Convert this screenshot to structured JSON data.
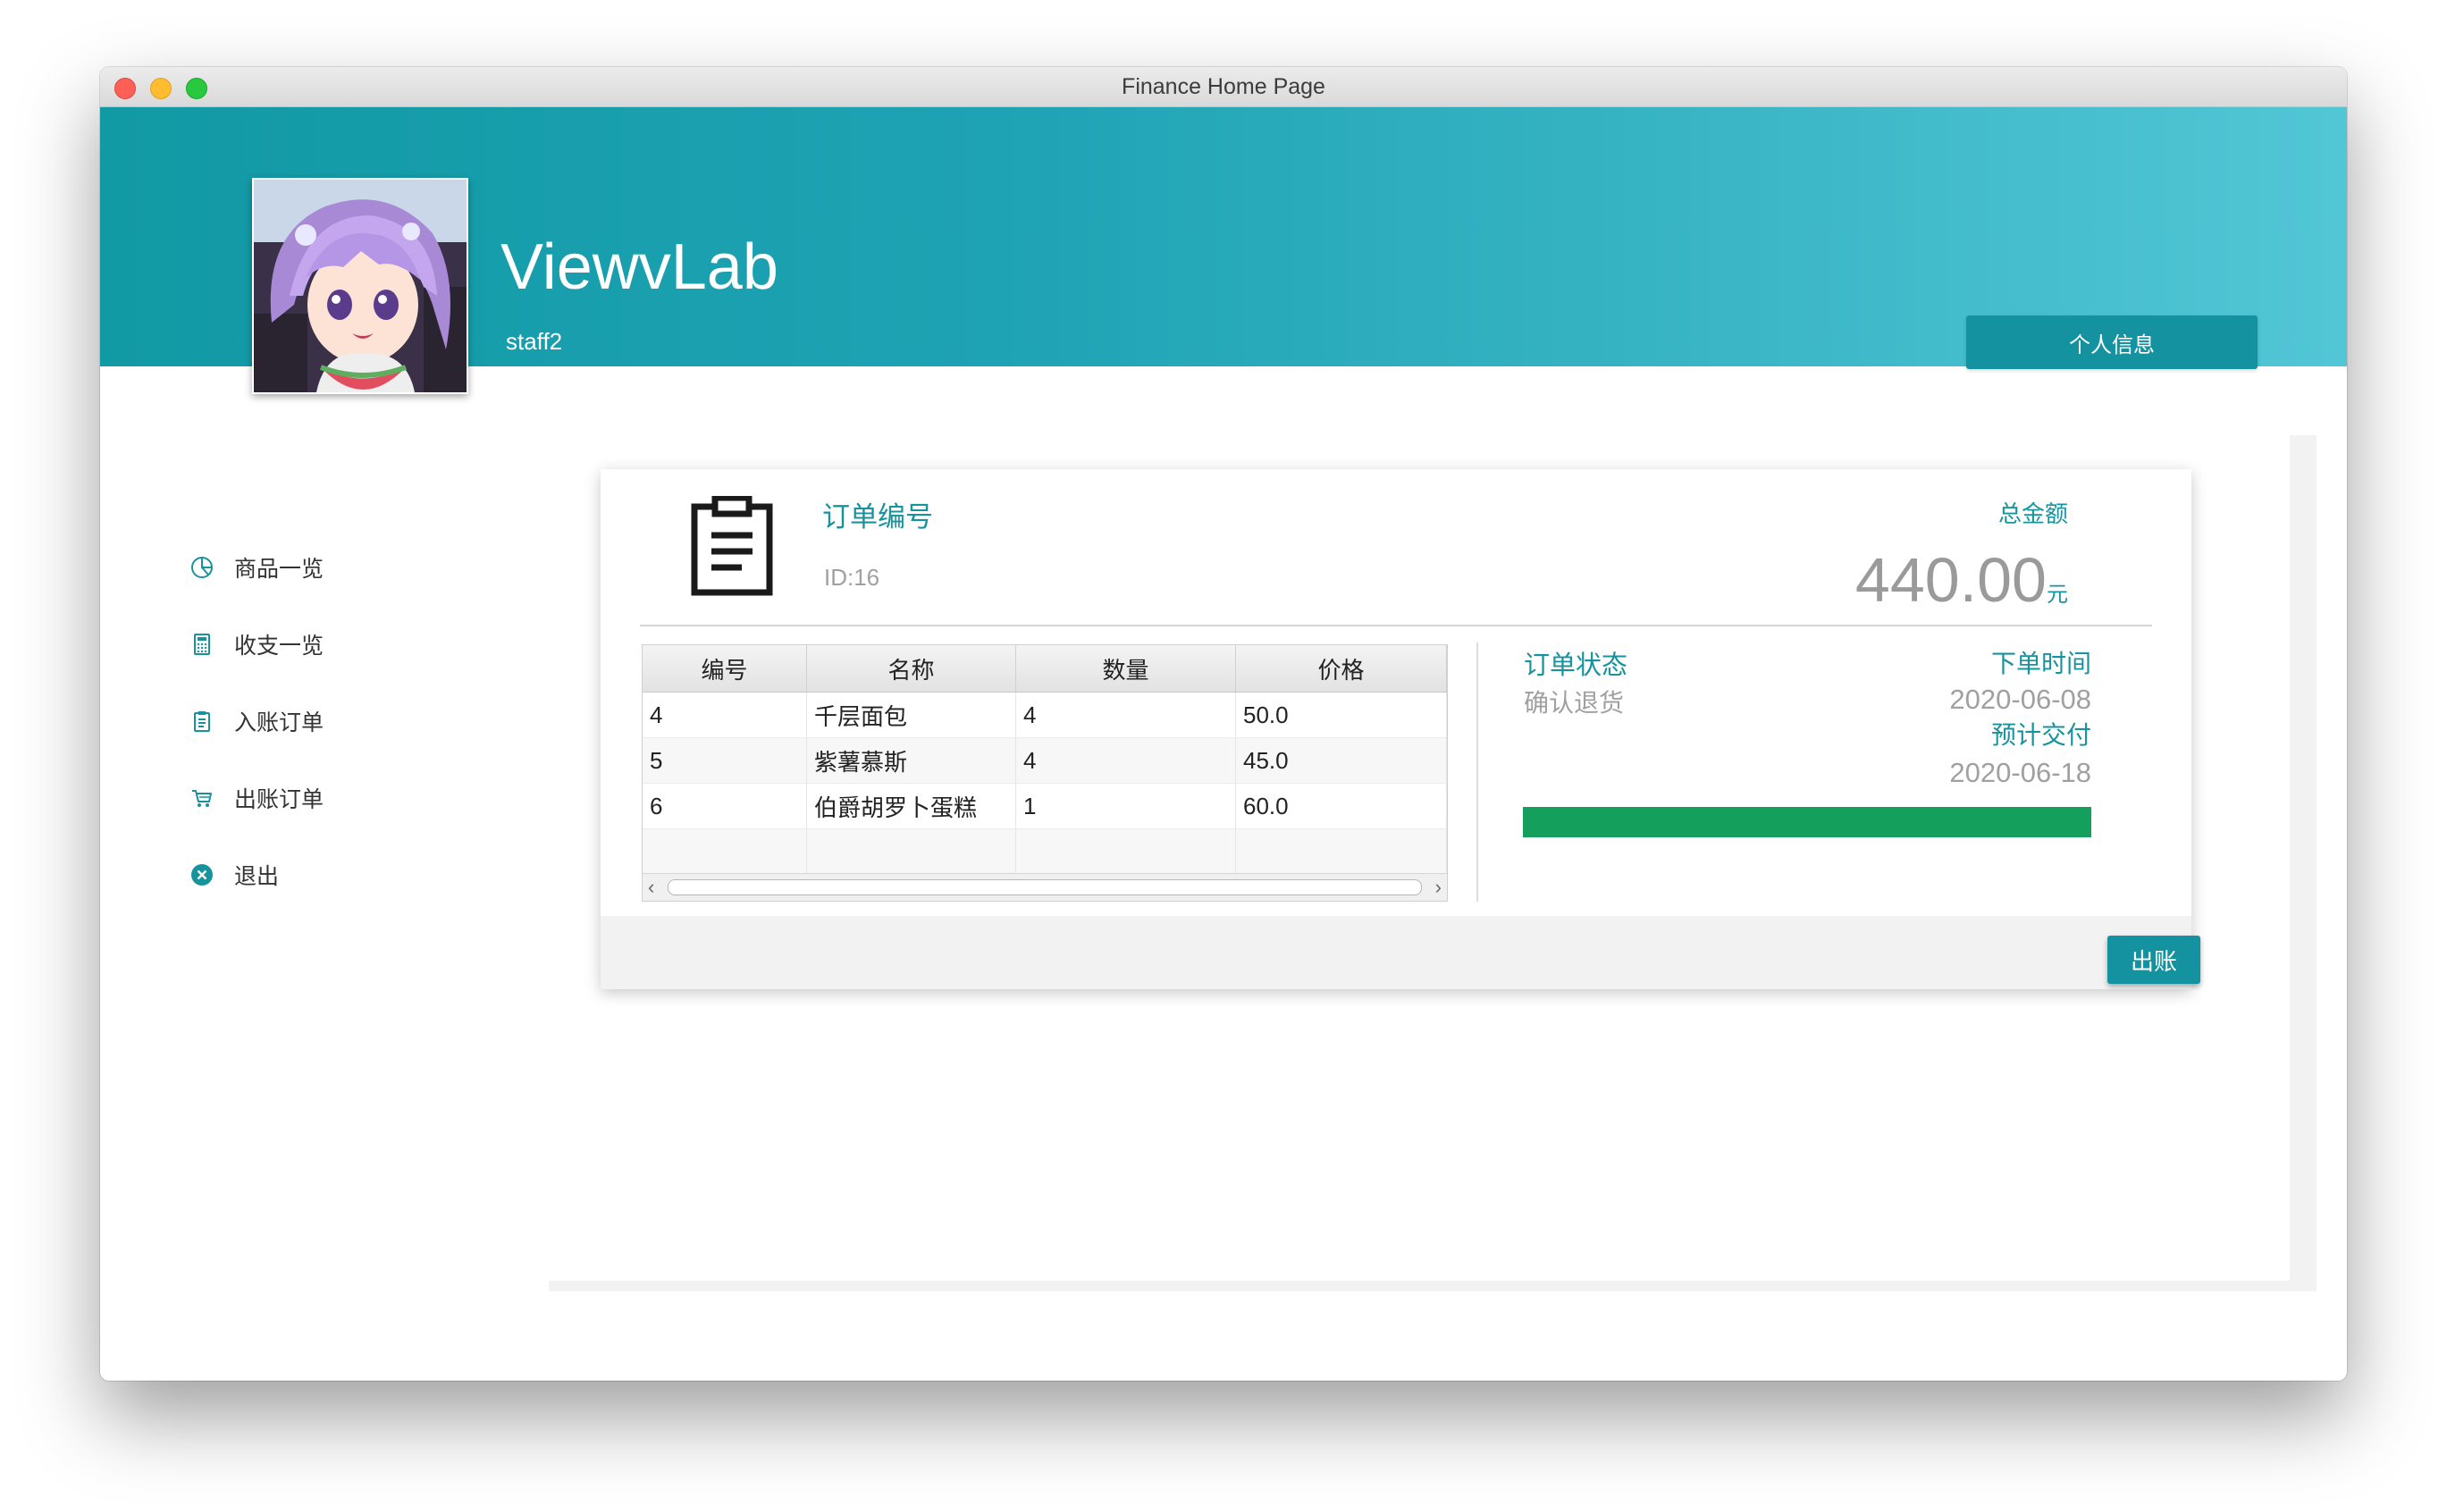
{
  "window": {
    "title": "Finance Home Page"
  },
  "header": {
    "app_title": "ViewvLab",
    "username": "staff2",
    "profile_button": "个人信息"
  },
  "sidebar": {
    "items": [
      {
        "label": "商品一览",
        "icon": "pie-chart-icon"
      },
      {
        "label": "收支一览",
        "icon": "calculator-icon"
      },
      {
        "label": "入账订单",
        "icon": "clipboard-icon"
      },
      {
        "label": "出账订单",
        "icon": "cart-icon"
      },
      {
        "label": "退出",
        "icon": "close-circle-icon"
      }
    ]
  },
  "order": {
    "number_label": "订单编号",
    "id": "ID:16",
    "total_label": "总金额",
    "total": "440.00",
    "currency": "元",
    "status_label": "订单状态",
    "status": "确认退货",
    "order_time_label": "下单时间",
    "order_time": "2020-06-08",
    "delivery_label": "预计交付",
    "delivery_time": "2020-06-18",
    "progress": 1.0,
    "checkout_button": "出账"
  },
  "table": {
    "columns": [
      "编号",
      "名称",
      "数量",
      "价格"
    ],
    "rows": [
      [
        "4",
        "千层面包",
        "4",
        "50.0"
      ],
      [
        "5",
        "紫薯慕斯",
        "4",
        "45.0"
      ],
      [
        "6",
        "伯爵胡罗卜蛋糕",
        "1",
        "60.0"
      ]
    ]
  },
  "colors": {
    "accent": "#17939e",
    "header_start": "#1199a4",
    "header_end": "#52c6d5",
    "progress": "#14a05c"
  }
}
